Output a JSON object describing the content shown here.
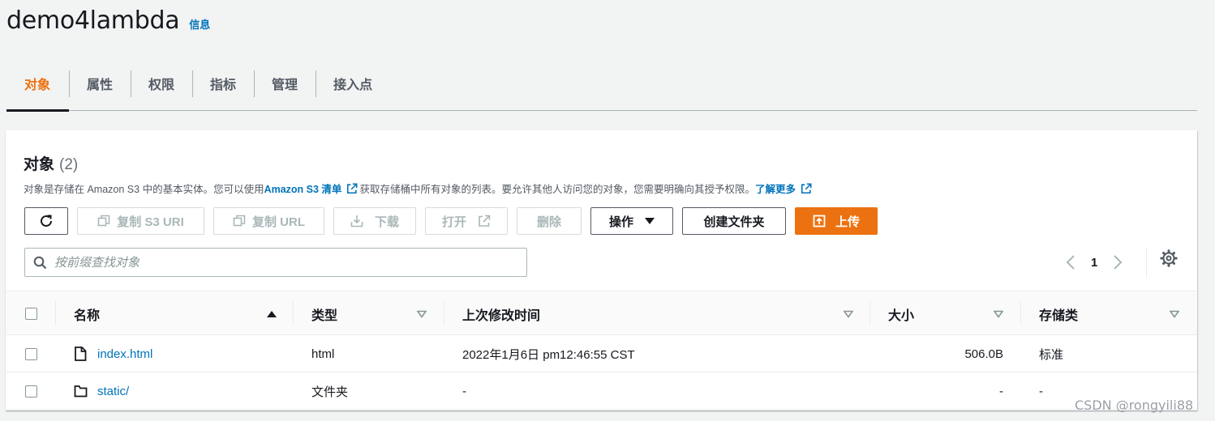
{
  "bucket": {
    "name": "demo4lambda",
    "info_link": "信息"
  },
  "tabs": [
    "对象",
    "属性",
    "权限",
    "指标",
    "管理",
    "接入点"
  ],
  "objects": {
    "title": "对象",
    "count": "(2)",
    "description_pre": "对象是存储在 Amazon S3 中的基本实体。您可以使用 ",
    "inventory_link": "Amazon S3 清单",
    "description_mid": "获取存储桶中所有对象的列表。要允许其他人访问您的对象，您需要明确向其授予权限。",
    "learn_more": "了解更多"
  },
  "toolbar": {
    "copy_s3_uri": "复制 S3 URI",
    "copy_url": "复制 URL",
    "download": "下载",
    "open": "打开",
    "delete": "删除",
    "actions": "操作",
    "create_folder": "创建文件夹",
    "upload": "上传"
  },
  "search": {
    "placeholder": "按前缀查找对象"
  },
  "pagination": {
    "current_page": "1"
  },
  "table": {
    "columns": [
      "名称",
      "类型",
      "上次修改时间",
      "大小",
      "存储类"
    ],
    "rows": [
      {
        "name": "index.html",
        "icon": "file-icon",
        "type": "html",
        "modified": "2022年1月6日 pm12:46:55 CST",
        "size": "506.0B",
        "storage": "标准"
      },
      {
        "name": "static/",
        "icon": "folder-icon",
        "type": "文件夹",
        "modified": "-",
        "size": "-",
        "storage": "-"
      }
    ]
  },
  "watermark": "CSDN @rongyili88",
  "colors": {
    "accent": "#ec7211",
    "link": "#0073bb",
    "text": "#16191f",
    "muted": "#545b64",
    "background": "#f2f3f3"
  }
}
